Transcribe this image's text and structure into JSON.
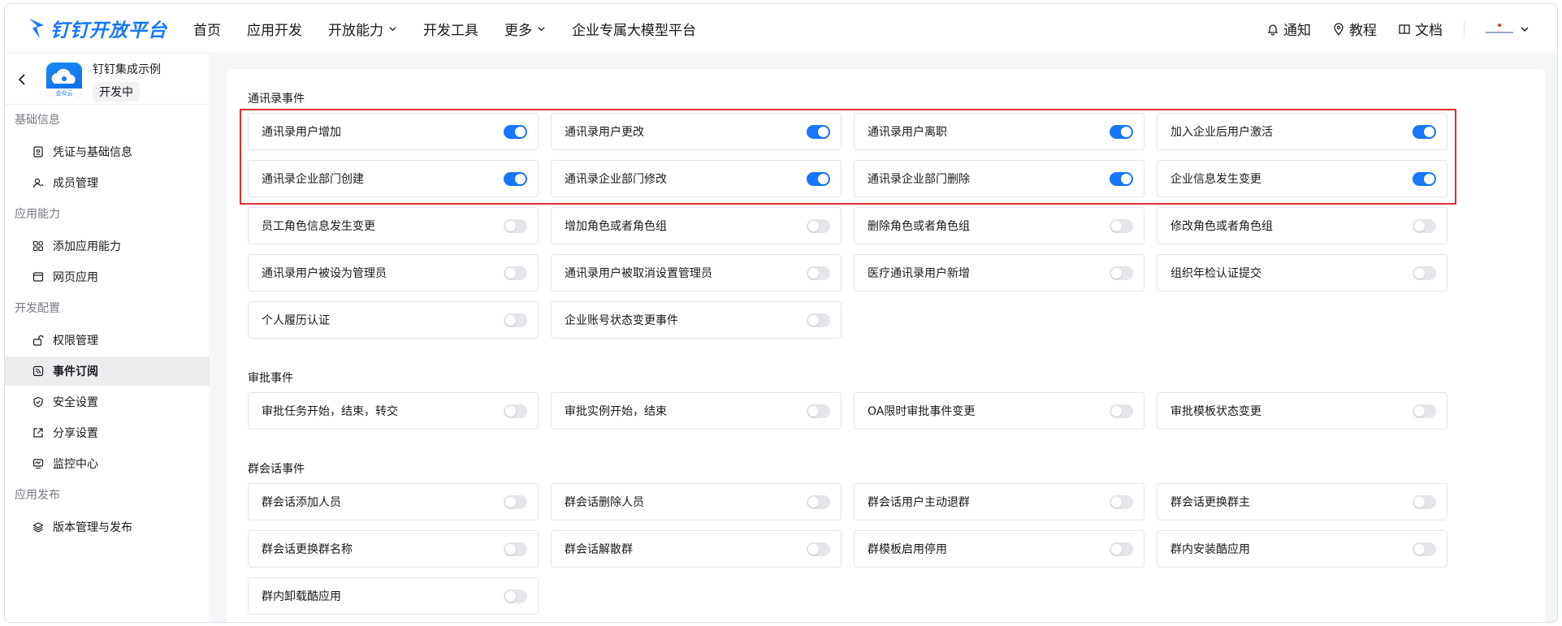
{
  "header": {
    "brand": "钉钉开放平台",
    "nav": [
      {
        "label": "首页",
        "dropdown": false
      },
      {
        "label": "应用开发",
        "dropdown": false
      },
      {
        "label": "开放能力",
        "dropdown": true
      },
      {
        "label": "开发工具",
        "dropdown": false
      },
      {
        "label": "更多",
        "dropdown": true
      },
      {
        "label": "企业专属大模型平台",
        "dropdown": false
      }
    ],
    "notify": "通知",
    "tutorial": "教程",
    "docs": "文档"
  },
  "app": {
    "name": "钉钉集成示例",
    "status": "开发中",
    "icon_tag": "会众云"
  },
  "sidebar": {
    "basic": {
      "title": "基础信息",
      "items": [
        "凭证与基础信息",
        "成员管理"
      ]
    },
    "ability": {
      "title": "应用能力",
      "items": [
        "添加应用能力",
        "网页应用"
      ]
    },
    "devconf": {
      "title": "开发配置",
      "items": [
        "权限管理",
        "事件订阅",
        "安全设置",
        "分享设置",
        "监控中心"
      ]
    },
    "publish": {
      "title": "应用发布",
      "items": [
        "版本管理与发布"
      ]
    }
  },
  "groups": {
    "contacts": {
      "title": "通讯录事件",
      "events": [
        {
          "label": "通讯录用户增加",
          "on": true
        },
        {
          "label": "通讯录用户更改",
          "on": true
        },
        {
          "label": "通讯录用户离职",
          "on": true
        },
        {
          "label": "加入企业后用户激活",
          "on": true
        },
        {
          "label": "通讯录企业部门创建",
          "on": true
        },
        {
          "label": "通讯录企业部门修改",
          "on": true
        },
        {
          "label": "通讯录企业部门删除",
          "on": true
        },
        {
          "label": "企业信息发生变更",
          "on": true
        },
        {
          "label": "员工角色信息发生变更",
          "on": false
        },
        {
          "label": "增加角色或者角色组",
          "on": false
        },
        {
          "label": "删除角色或者角色组",
          "on": false
        },
        {
          "label": "修改角色或者角色组",
          "on": false
        },
        {
          "label": "通讯录用户被设为管理员",
          "on": false
        },
        {
          "label": "通讯录用户被取消设置管理员",
          "on": false
        },
        {
          "label": "医疗通讯录用户新增",
          "on": false
        },
        {
          "label": "组织年检认证提交",
          "on": false
        },
        {
          "label": "个人履历认证",
          "on": false
        },
        {
          "label": "企业账号状态变更事件",
          "on": false
        }
      ]
    },
    "approval": {
      "title": "审批事件",
      "events": [
        {
          "label": "审批任务开始，结束，转交",
          "on": false
        },
        {
          "label": "审批实例开始，结束",
          "on": false
        },
        {
          "label": "OA限时审批事件变更",
          "on": false
        },
        {
          "label": "审批模板状态变更",
          "on": false
        }
      ]
    },
    "chat": {
      "title": "群会话事件",
      "events": [
        {
          "label": "群会话添加人员",
          "on": false
        },
        {
          "label": "群会话删除人员",
          "on": false
        },
        {
          "label": "群会话用户主动退群",
          "on": false
        },
        {
          "label": "群会话更换群主",
          "on": false
        },
        {
          "label": "群会话更换群名称",
          "on": false
        },
        {
          "label": "群会话解散群",
          "on": false
        },
        {
          "label": "群模板启用停用",
          "on": false
        },
        {
          "label": "群内安装酷应用",
          "on": false
        },
        {
          "label": "群内卸载酷应用",
          "on": false
        }
      ]
    }
  }
}
